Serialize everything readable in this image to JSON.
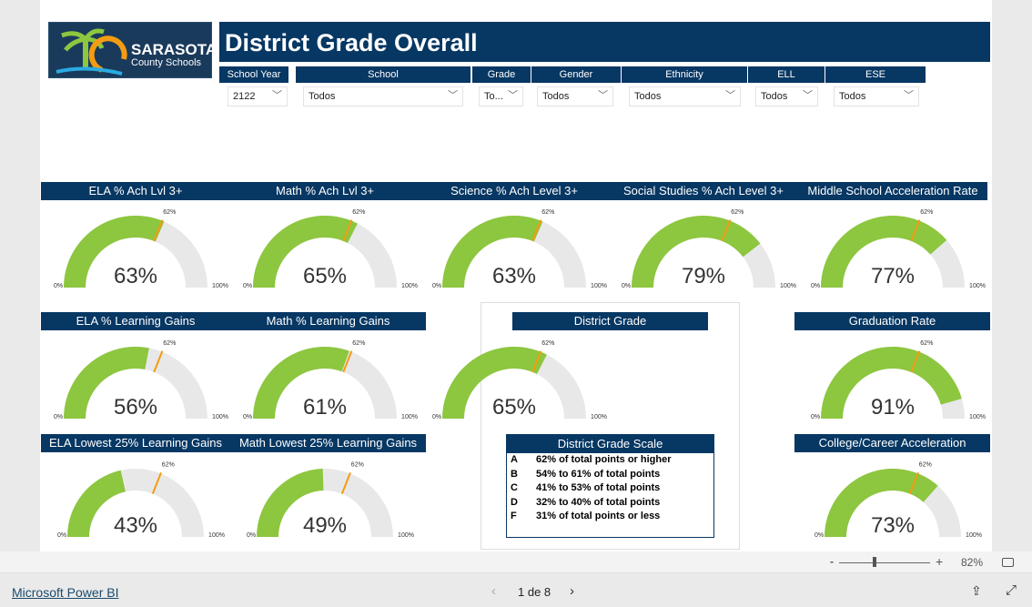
{
  "logo": {
    "line1": "SARASOTA",
    "line2": "County Schools"
  },
  "title": "District Grade Overall",
  "filters": [
    {
      "label": "School Year",
      "value": "2122"
    },
    {
      "label": "School",
      "value": "Todos"
    },
    {
      "label": "Grade",
      "value": "To..."
    },
    {
      "label": "Gender",
      "value": "Todos"
    },
    {
      "label": "Ethnicity",
      "value": "Todos"
    },
    {
      "label": "ELL",
      "value": "Todos"
    },
    {
      "label": "ESE",
      "value": "Todos"
    }
  ],
  "gauge_colors": {
    "fill": "#8dc63f",
    "track": "#e8e8e8",
    "target": "#f39c12"
  },
  "gauges": [
    {
      "title": "ELA % Ach Lvl 3+",
      "value": 63,
      "target": 62,
      "min": "0%",
      "max": "100%"
    },
    {
      "title": "Math % Ach Lvl 3+",
      "value": 65,
      "target": 62,
      "min": "0%",
      "max": "100%"
    },
    {
      "title": "Science % Ach Level 3+",
      "value": 63,
      "target": 62,
      "min": "0%",
      "max": "100%"
    },
    {
      "title": "Social Studies % Ach Level 3+",
      "value": 79,
      "target": 62,
      "min": "0%",
      "max": "100%"
    },
    {
      "title": "Middle School Acceleration Rate",
      "value": 77,
      "target": 62,
      "min": "0%",
      "max": "100%"
    },
    {
      "title": "ELA % Learning Gains",
      "value": 56,
      "target": 62,
      "min": "0%",
      "max": "100%"
    },
    {
      "title": "Math % Learning Gains",
      "value": 61,
      "target": 62,
      "min": "0%",
      "max": "100%"
    },
    {
      "title": "District Grade",
      "value": 65,
      "target": 62,
      "min": "0%",
      "max": "100%"
    },
    {
      "title": "Graduation Rate",
      "value": 91,
      "target": 62,
      "min": "0%",
      "max": "100%"
    },
    {
      "title": "ELA Lowest 25% Learning Gains",
      "value": 43,
      "target": 62,
      "min": "0%",
      "max": "100%"
    },
    {
      "title": "Math Lowest 25% Learning Gains",
      "value": 49,
      "target": 62,
      "min": "0%",
      "max": "100%"
    },
    {
      "title": "College/Career Acceleration",
      "value": 73,
      "target": 62,
      "min": "0%",
      "max": "100%"
    }
  ],
  "scale": {
    "title": "District Grade Scale",
    "rows": [
      {
        "grade": "A",
        "text": "62% of total points or higher"
      },
      {
        "grade": "B",
        "text": "54% to 61% of total points"
      },
      {
        "grade": "C",
        "text": "41% to 53% of total points"
      },
      {
        "grade": "D",
        "text": "32% to 40% of total points"
      },
      {
        "grade": "F",
        "text": "31% of total points or less"
      }
    ]
  },
  "zoom": {
    "minus": "-",
    "plus": "+",
    "level": "82%"
  },
  "footer": {
    "brand": "Microsoft Power BI",
    "page": "1 de 8"
  }
}
